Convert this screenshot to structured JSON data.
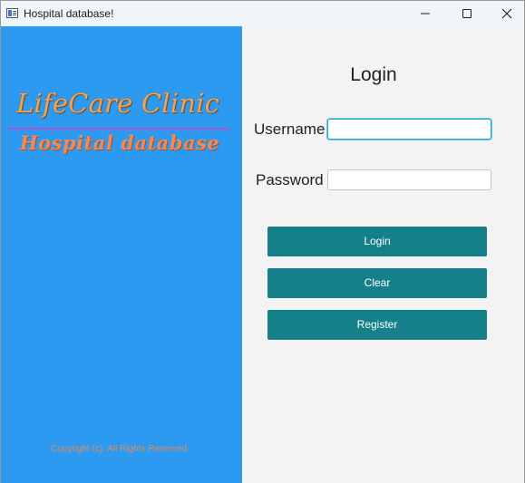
{
  "window": {
    "title": "Hospital database!"
  },
  "branding": {
    "clinic_name": "LifeCare Clinic",
    "subtitle": "Hospital database",
    "copyright": "Copyright (c). All Rights Reserved"
  },
  "login_form": {
    "heading": "Login",
    "username_label": "Username",
    "username_value": "",
    "password_label": "Password",
    "password_value": "",
    "login_button": "Login",
    "clear_button": "Clear",
    "register_button": "Register"
  },
  "colors": {
    "left_panel": "#2b9af0",
    "button": "#158089",
    "brand_text": "#f2a35a",
    "divider": "#b44fcf"
  },
  "icons": {
    "app": "app-window-icon",
    "minimize": "minimize-icon",
    "maximize": "maximize-icon",
    "close": "close-icon"
  }
}
